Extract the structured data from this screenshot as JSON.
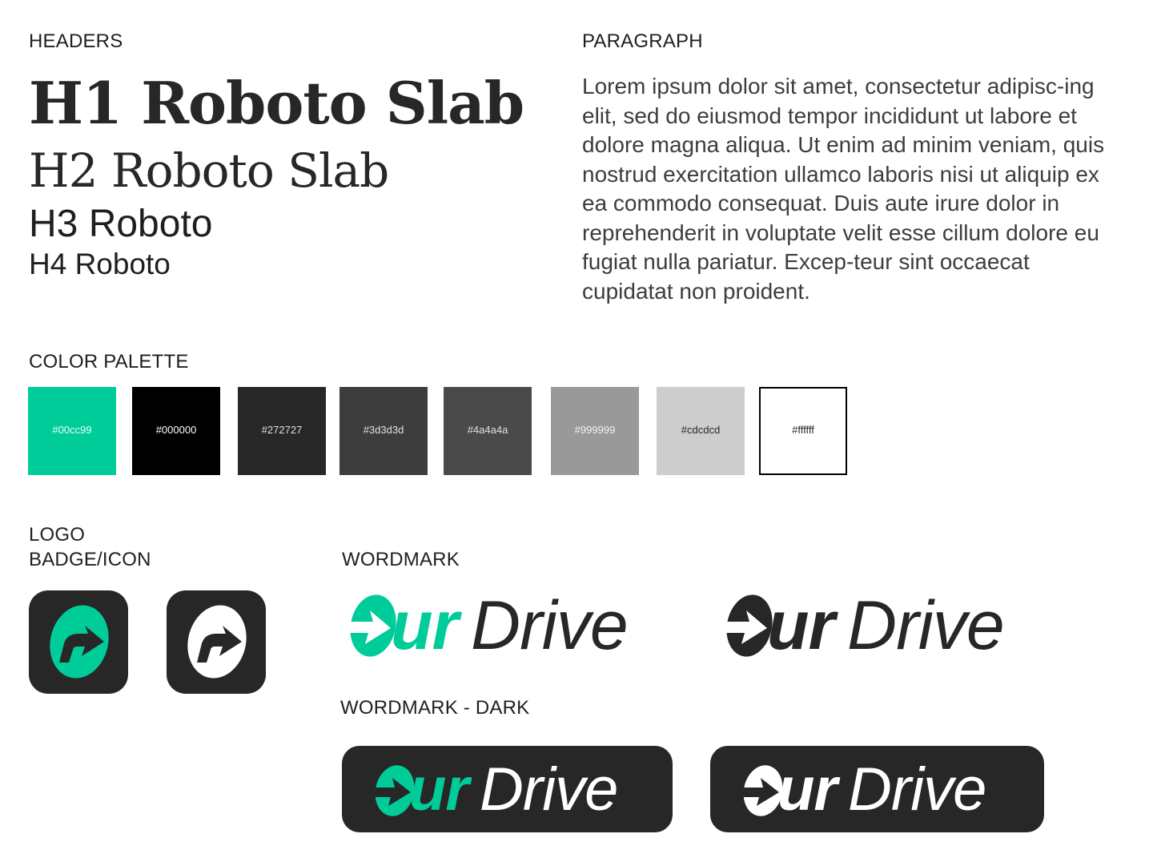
{
  "sections": {
    "headers": "HEADERS",
    "paragraph": "PARAGRAPH",
    "color_palette": "COLOR PALETTE",
    "logo": "LOGO",
    "badge_icon": "BADGE/ICON",
    "wordmark": "WORDMARK",
    "wordmark_dark": "WORDMARK - DARK"
  },
  "headers": {
    "h1": "H1 Roboto Slab",
    "h2": "H2 Roboto Slab",
    "h3": "H3 Roboto",
    "h4": "H4 Roboto"
  },
  "paragraph_text": "Lorem ipsum dolor sit amet, consectetur adipisc-ing elit, sed do eiusmod tempor incididunt ut labore et dolore magna aliqua. Ut enim ad minim veniam, quis nostrud exercitation ullamco laboris nisi ut aliquip ex ea commodo consequat. Duis aute irure dolor in reprehenderit in voluptate velit esse cillum dolore eu fugiat nulla pariatur. Excep-teur sint occaecat cupidatat non proident.",
  "palette": [
    {
      "hex": "#00cc99",
      "label": "#00cc99",
      "text_color": "#e6fff7"
    },
    {
      "hex": "#000000",
      "label": "#000000",
      "text_color": "#ffffff"
    },
    {
      "hex": "#272727",
      "label": "#272727",
      "text_color": "#e0e0e0"
    },
    {
      "hex": "#3d3d3d",
      "label": "#3d3d3d",
      "text_color": "#e0e0e0"
    },
    {
      "hex": "#4a4a4a",
      "label": "#4a4a4a",
      "text_color": "#e0e0e0"
    },
    {
      "hex": "#999999",
      "label": "#999999",
      "text_color": "#f0f0f0"
    },
    {
      "hex": "#cdcdcd",
      "label": "#cdcdcd",
      "text_color": "#272727"
    },
    {
      "hex": "#ffffff",
      "label": "#ffffff",
      "text_color": "#272727"
    }
  ],
  "logo": {
    "prefix": "ur",
    "name": "Drive",
    "accent_color": "#00cc99",
    "dark_color": "#272727",
    "icon": "arrow-circle-icon"
  }
}
